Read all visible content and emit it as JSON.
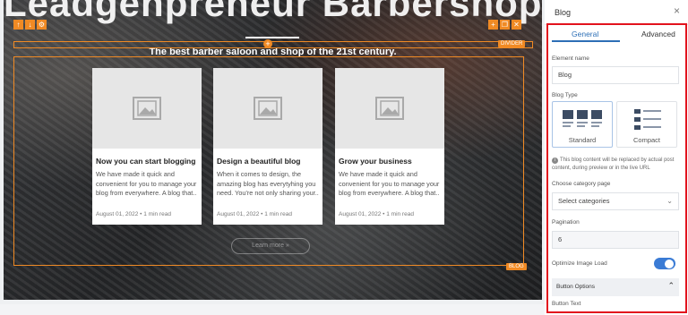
{
  "canvas": {
    "hero_title": "Leadgenpreneur Barbershop",
    "hero_subtitle": "The best barber saloon and shop of the 21st century.",
    "badge_top": "DIVIDER",
    "badge_bottom": "BLOG",
    "more_button": "Learn more  »",
    "posts": [
      {
        "title": "Now you can start blogging",
        "excerpt": "We have made it quick and convenient for you to manage your blog from everywhere. A blog that..",
        "meta": "August 01, 2022  •  1 min read"
      },
      {
        "title": "Design a beautiful blog",
        "excerpt": "When it comes to design, the amazing blog has everytyhing you need. You're not only sharing your..",
        "meta": "August 01, 2022  •  1 min read"
      },
      {
        "title": "Grow your business",
        "excerpt": "We have made it quick and convenient for you to manage your blog from everywhere. A blog that..",
        "meta": "August 01, 2022  •  1 min read"
      }
    ]
  },
  "panel": {
    "title": "Blog",
    "close": "×",
    "tabs": [
      "General",
      "Advanced"
    ],
    "element_name_label": "Element name",
    "element_name_value": "Blog",
    "blog_type_label": "Blog Type",
    "blog_types": [
      "Standard",
      "Compact"
    ],
    "notice": "This blog content will be replaced by actual post content, during preview or in the live URL",
    "category_label": "Choose category page",
    "category_placeholder": "Select categories",
    "pagination_label": "Pagination",
    "pagination_value": "6",
    "optimize_label": "Optimize Image Load",
    "button_options_label": "Button Options",
    "button_text_label": "Button Text"
  },
  "colors": {
    "accent": "#2d6fb6",
    "selection": "#f08a24",
    "highlight": "#e2131d"
  }
}
